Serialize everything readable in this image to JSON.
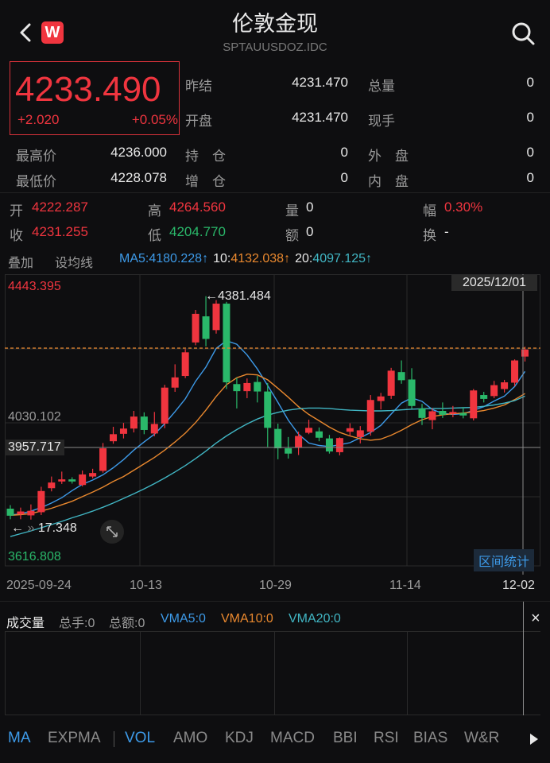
{
  "header": {
    "title": "伦敦金现",
    "subtitle": "SPTAUUSDOZ.IDC",
    "badge": "W"
  },
  "quote": {
    "price": "4233.490",
    "change": "+2.020",
    "change_pct": "+0.05%",
    "fields": [
      {
        "label": "昨结",
        "value": "4231.470"
      },
      {
        "label": "开盘",
        "value": "4231.470"
      },
      {
        "label": "总量",
        "value": "0"
      },
      {
        "label": "现手",
        "value": "0"
      },
      {
        "label": "最高价",
        "value": "4236.000"
      },
      {
        "label": "最低价",
        "value": "4228.078"
      },
      {
        "label": "持　仓",
        "value": "0"
      },
      {
        "label": "增　仓",
        "value": "0"
      },
      {
        "label": "外　盘",
        "value": "0"
      },
      {
        "label": "内　盘",
        "value": "0"
      }
    ]
  },
  "kline_info": {
    "open_label": "开",
    "open": "4222.287",
    "high_label": "高",
    "high": "4264.560",
    "vol_label": "量",
    "vol": "0",
    "amp_label": "幅",
    "amp": "0.30%",
    "close_label": "收",
    "close": "4231.255",
    "low_label": "低",
    "low": "4204.770",
    "amount_label": "额",
    "amount": "0",
    "turnover_label": "换",
    "turnover": "-"
  },
  "ma_bar": {
    "overlay": "叠加",
    "set_ma": "设均线",
    "ma5": "MA5:4180.228↑",
    "ma10_label": "10:",
    "ma10": "4132.038↑",
    "ma20_label": "20:",
    "ma20": "4097.125↑"
  },
  "chart_labels": {
    "top_price": "4443.395",
    "mid_price": "4030.102",
    "cursor_price": "3957.717",
    "bottom_price": "3616.808",
    "cursor_date": "2025/12/01",
    "max_marker": "4381.484",
    "min_marker": "17.348",
    "range_stats": "区间统计",
    "dates": [
      "2025-09-24",
      "10-13",
      "10-29",
      "11-14",
      "12-02"
    ]
  },
  "volume_bar": {
    "title": "成交量",
    "total_hands": "总手:0",
    "total_amount": "总额:0",
    "vma5": "VMA5:0",
    "vma10": "VMA10:0",
    "vma20": "VMA20:0",
    "close": "×"
  },
  "tabs": [
    "MA",
    "EXPMA",
    "VOL",
    "AMO",
    "KDJ",
    "MACD",
    "BBI",
    "RSI",
    "BIAS",
    "W&R"
  ],
  "colors": {
    "up": "#f0353f",
    "down": "#2ab86a",
    "ma5": "#3d9ae8",
    "ma10": "#e9882e",
    "ma20": "#41b6c4"
  },
  "chart_data": {
    "type": "candlestick",
    "ylim": [
      3616.808,
      4443.395
    ],
    "candles": [
      {
        "o": 3779,
        "c": 3759,
        "h": 3789,
        "l": 3749
      },
      {
        "o": 3763,
        "c": 3771,
        "h": 3782,
        "l": 3749
      },
      {
        "o": 3760,
        "c": 3773,
        "h": 3791,
        "l": 3748
      },
      {
        "o": 3769,
        "c": 3829,
        "h": 3841,
        "l": 3761
      },
      {
        "o": 3837,
        "c": 3853,
        "h": 3870,
        "l": 3828
      },
      {
        "o": 3856,
        "c": 3862,
        "h": 3884,
        "l": 3849
      },
      {
        "o": 3862,
        "c": 3856,
        "h": 3868,
        "l": 3850
      },
      {
        "o": 3846,
        "c": 3876,
        "h": 3887,
        "l": 3842
      },
      {
        "o": 3870,
        "c": 3880,
        "h": 3892,
        "l": 3865
      },
      {
        "o": 3886,
        "c": 3950,
        "h": 3965,
        "l": 3881
      },
      {
        "o": 3970,
        "c": 3990,
        "h": 4011,
        "l": 3963
      },
      {
        "o": 3991,
        "c": 4006,
        "h": 4022,
        "l": 3978
      },
      {
        "o": 4006,
        "c": 4040,
        "h": 4056,
        "l": 3995
      },
      {
        "o": 4040,
        "c": 4002,
        "h": 4052,
        "l": 3990
      },
      {
        "o": 3992,
        "c": 4019,
        "h": 4053,
        "l": 3984
      },
      {
        "o": 4020,
        "c": 4122,
        "h": 4130,
        "l": 4007
      },
      {
        "o": 4122,
        "c": 4151,
        "h": 4188,
        "l": 4110
      },
      {
        "o": 4155,
        "c": 4222,
        "h": 4231,
        "l": 4149
      },
      {
        "o": 4250,
        "c": 4331,
        "h": 4342,
        "l": 4242
      },
      {
        "o": 4324,
        "c": 4260,
        "h": 4381,
        "l": 4239
      },
      {
        "o": 4285,
        "c": 4360,
        "h": 4370,
        "l": 4275
      },
      {
        "o": 4360,
        "c": 4137,
        "h": 4365,
        "l": 4118
      },
      {
        "o": 4132,
        "c": 4112,
        "h": 4150,
        "l": 4063
      },
      {
        "o": 4112,
        "c": 4135,
        "h": 4148,
        "l": 4092
      },
      {
        "o": 4138,
        "c": 4111,
        "h": 4155,
        "l": 4080
      },
      {
        "o": 4111,
        "c": 4008,
        "h": 4135,
        "l": 3954
      },
      {
        "o": 4005,
        "c": 3950,
        "h": 4020,
        "l": 3919
      },
      {
        "o": 3950,
        "c": 3935,
        "h": 3982,
        "l": 3921
      },
      {
        "o": 3952,
        "c": 3985,
        "h": 3997,
        "l": 3931
      },
      {
        "o": 3994,
        "c": 4008,
        "h": 4031,
        "l": 3990
      },
      {
        "o": 3998,
        "c": 3980,
        "h": 4009,
        "l": 3970
      },
      {
        "o": 3978,
        "c": 3941,
        "h": 3988,
        "l": 3935
      },
      {
        "o": 3939,
        "c": 3979,
        "h": 3981,
        "l": 3930
      },
      {
        "o": 3997,
        "c": 4007,
        "h": 4021,
        "l": 3985
      },
      {
        "o": 3982,
        "c": 4001,
        "h": 4013,
        "l": 3964
      },
      {
        "o": 3997,
        "c": 4087,
        "h": 4101,
        "l": 3986
      },
      {
        "o": 4084,
        "c": 4097,
        "h": 4107,
        "l": 4060
      },
      {
        "o": 4099,
        "c": 4170,
        "h": 4178,
        "l": 4090
      },
      {
        "o": 4166,
        "c": 4143,
        "h": 4199,
        "l": 4133
      },
      {
        "o": 4145,
        "c": 4070,
        "h": 4177,
        "l": 4062
      },
      {
        "o": 4063,
        "c": 4036,
        "h": 4076,
        "l": 4016
      },
      {
        "o": 4030,
        "c": 4055,
        "h": 4064,
        "l": 4004
      },
      {
        "o": 4056,
        "c": 4045,
        "h": 4080,
        "l": 4036
      },
      {
        "o": 4048,
        "c": 4053,
        "h": 4070,
        "l": 4038
      },
      {
        "o": 4050,
        "c": 4043,
        "h": 4067,
        "l": 4035
      },
      {
        "o": 4035,
        "c": 4114,
        "h": 4118,
        "l": 4029
      },
      {
        "o": 4101,
        "c": 4090,
        "h": 4110,
        "l": 4080
      },
      {
        "o": 4098,
        "c": 4129,
        "h": 4141,
        "l": 4092
      },
      {
        "o": 4118,
        "c": 4137,
        "h": 4144,
        "l": 4108
      },
      {
        "o": 4136,
        "c": 4199,
        "h": 4202,
        "l": 4126
      },
      {
        "o": 4210,
        "c": 4230,
        "h": 4238,
        "l": 4196
      }
    ],
    "ma5": [
      3761,
      3764,
      3772,
      3782,
      3795,
      3810,
      3830,
      3848,
      3860,
      3875,
      3895,
      3918,
      3945,
      3968,
      3990,
      4020,
      4054,
      4090,
      4140,
      4180,
      4233,
      4255,
      4245,
      4215,
      4175,
      4128,
      4080,
      4030,
      3990,
      3965,
      3958,
      3955,
      3960,
      3966,
      3980,
      3995,
      4015,
      4047,
      4078,
      4093,
      4083,
      4060,
      4049,
      4046,
      4048,
      4058,
      4068,
      4084,
      4098,
      4125,
      4168
    ],
    "ma10": [
      3760,
      3762,
      3765,
      3772,
      3780,
      3790,
      3800,
      3813,
      3826,
      3840,
      3856,
      3870,
      3888,
      3906,
      3924,
      3945,
      3968,
      3993,
      4023,
      4058,
      4097,
      4130,
      4150,
      4160,
      4158,
      4144,
      4120,
      4095,
      4068,
      4046,
      4028,
      4010,
      3995,
      3985,
      3977,
      3973,
      3976,
      3987,
      4001,
      4017,
      4031,
      4040,
      4045,
      4048,
      4050,
      4053,
      4057,
      4064,
      4073,
      4088,
      4105
    ],
    "ma20": [
      3700,
      3708,
      3716,
      3725,
      3734,
      3743,
      3753,
      3762,
      3772,
      3783,
      3795,
      3808,
      3821,
      3835,
      3850,
      3866,
      3883,
      3901,
      3921,
      3942,
      3965,
      3985,
      4003,
      4019,
      4033,
      4044,
      4052,
      4058,
      4062,
      4064,
      4064,
      4063,
      4060,
      4058,
      4057,
      4056,
      4056,
      4057,
      4059,
      4061,
      4062,
      4063,
      4063,
      4064,
      4065,
      4066,
      4069,
      4073,
      4078,
      4085,
      4098
    ]
  }
}
